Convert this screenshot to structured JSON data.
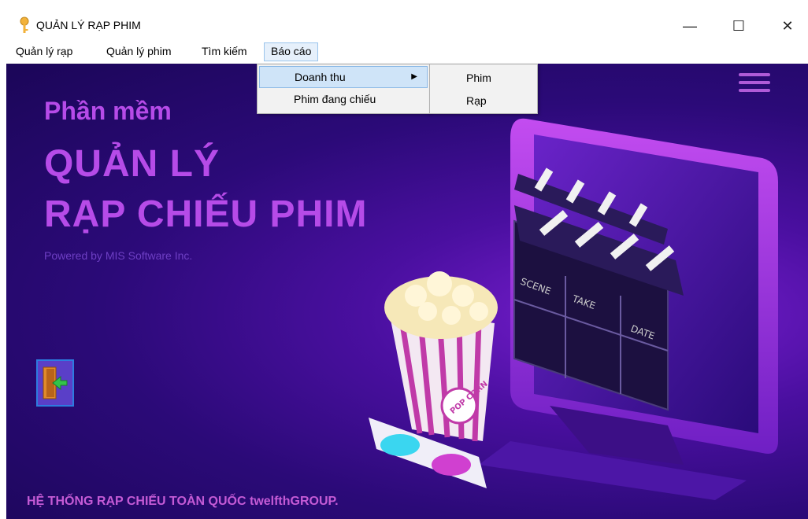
{
  "window": {
    "title": "QUẢN LÝ RẠP PHIM",
    "icon": "key-icon",
    "controls": {
      "minimize": "—",
      "maximize": "☐",
      "close": "✕"
    }
  },
  "menubar": {
    "items": [
      "Quản lý rạp",
      "Quản lý phim",
      "Tìm kiếm",
      "Báo cáo"
    ],
    "active": "Báo cáo"
  },
  "dropdown": {
    "items": [
      "Doanh thu",
      "Phim đang chiếu"
    ],
    "highlighted": "Doanh thu",
    "submenu_arrow": "▶"
  },
  "submenu": {
    "items": [
      "Phim",
      "Rạp"
    ]
  },
  "hero": {
    "line1": "Phần mềm",
    "line2": "QUẢN LÝ",
    "line3": "RẠP CHIẾU PHIM",
    "powered": "Powered by MIS Software Inc."
  },
  "footer": {
    "text": "HỆ THỐNG RẠP CHIẾU TOÀN QUỐC twelfthGROUP."
  },
  "illustration": {
    "clapper_labels": [
      "SCENE",
      "TAKE",
      "DATE"
    ],
    "popcorn_label": "POP CORN"
  },
  "colors": {
    "accent": "#b64be8",
    "background_dark": "#2b0a78",
    "menu_highlight": "#cfe4f8"
  }
}
